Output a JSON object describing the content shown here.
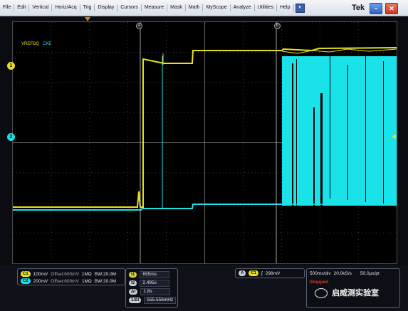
{
  "menu": {
    "items": [
      "File",
      "Edit",
      "Vertical",
      "Horiz/Acq",
      "Trig",
      "Display",
      "Cursors",
      "Measure",
      "Mask",
      "Math",
      "MyScope",
      "Analyze",
      "Utilities",
      "Help"
    ],
    "brand": "Tek"
  },
  "traces": {
    "ch1_label": "VREFDQ",
    "ch2_label": "CKE",
    "ch1_marker": "1",
    "ch2_marker": "2",
    "cursor_a": "a",
    "cursor_b": "b",
    "ch1_color": "#e8e020",
    "ch2_color": "#19e3e8"
  },
  "channels": [
    {
      "id": "C1",
      "scale": "100mV",
      "offset": "Offset:600mV",
      "coupling": "1MΩ",
      "bw": "BW:20.0M"
    },
    {
      "id": "C2",
      "scale": "200mV",
      "offset": "Offset:600mV",
      "coupling": "1MΩ",
      "bw": "BW:20.0M"
    }
  ],
  "cursors": {
    "rows": [
      {
        "tag": "t1",
        "value": "695ms"
      },
      {
        "tag": "t2",
        "value": "2.495s"
      },
      {
        "tag": "Δt",
        "value": "1.8s"
      },
      {
        "tag": "1/Δt",
        "value": "555.556mHz"
      }
    ]
  },
  "trigger": {
    "mode": "A",
    "source": "C1",
    "level": "298mV"
  },
  "horizontal": {
    "scale": "500ms/div",
    "rate": "20.0kS/s",
    "resolution": "50.0μs/pt",
    "state": "Stopped"
  },
  "watermark": "启威测实验室"
}
